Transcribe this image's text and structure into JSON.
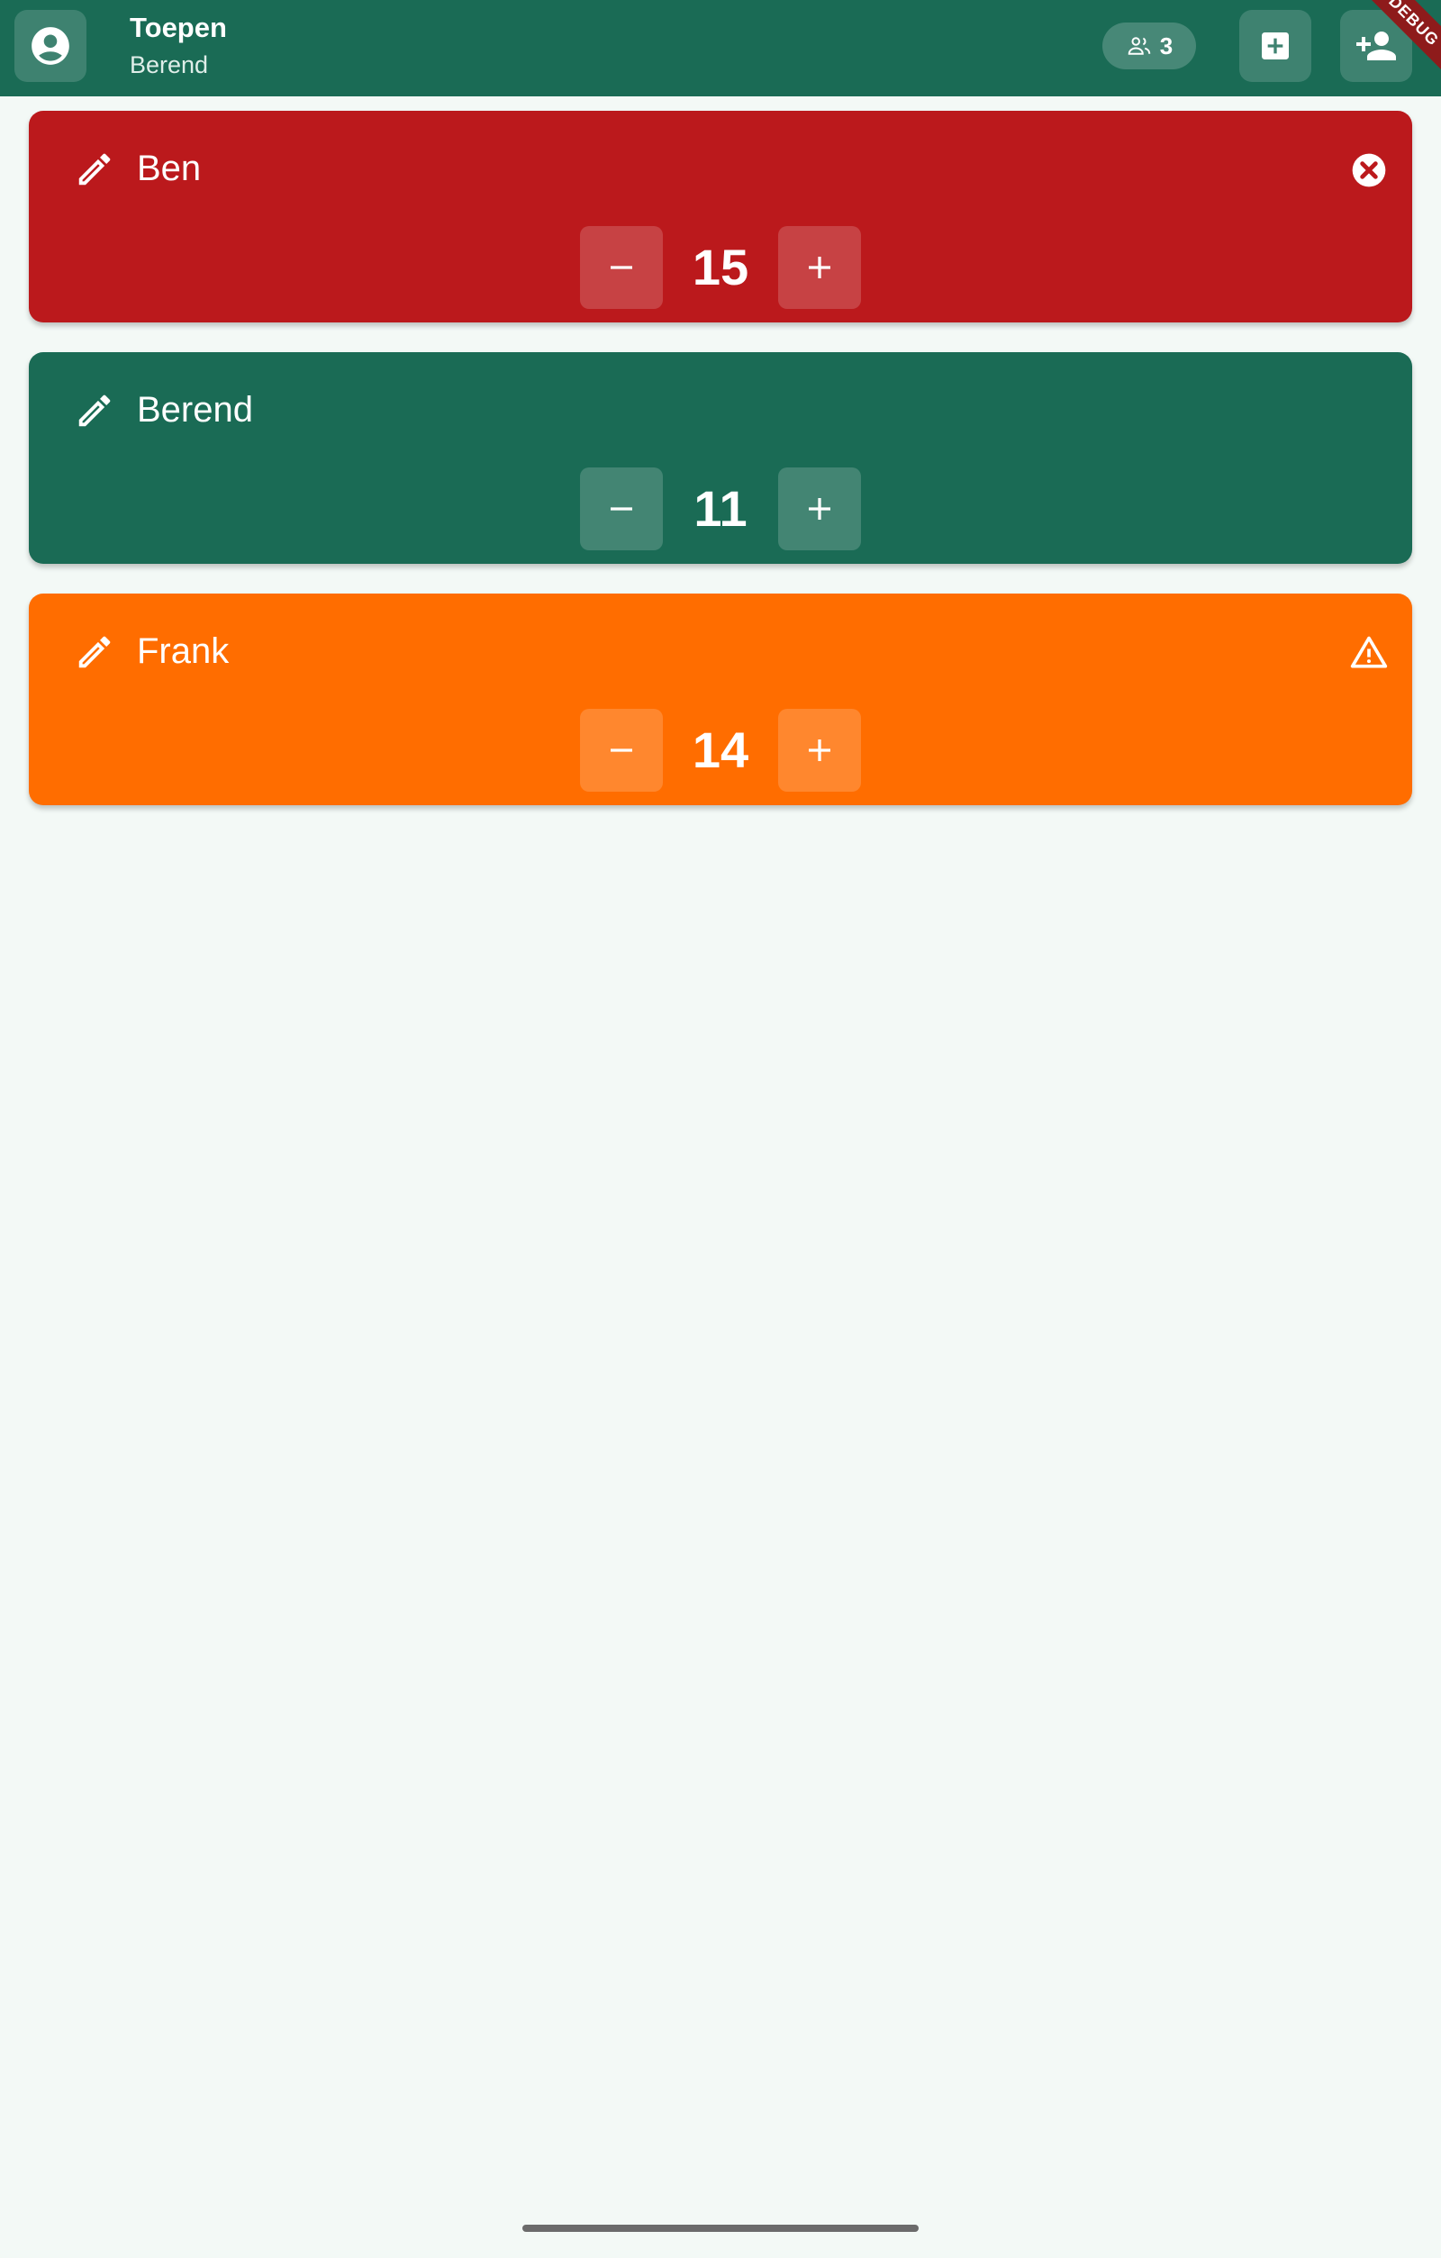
{
  "app": {
    "title": "Toepen",
    "subtitle": "Berend",
    "player_count": "3",
    "debug_label": "DEBUG",
    "colors": {
      "bar": "#1a6b55",
      "background": "#f3f9f6"
    }
  },
  "players": [
    {
      "name": "Ben",
      "score": "15",
      "color": "#bb191c",
      "status_icon": "close-circle-icon"
    },
    {
      "name": "Berend",
      "score": "11",
      "color": "#1a6b55",
      "status_icon": ""
    },
    {
      "name": "Frank",
      "score": "14",
      "color": "#ff6d00",
      "status_icon": "warning-triangle-icon"
    }
  ]
}
